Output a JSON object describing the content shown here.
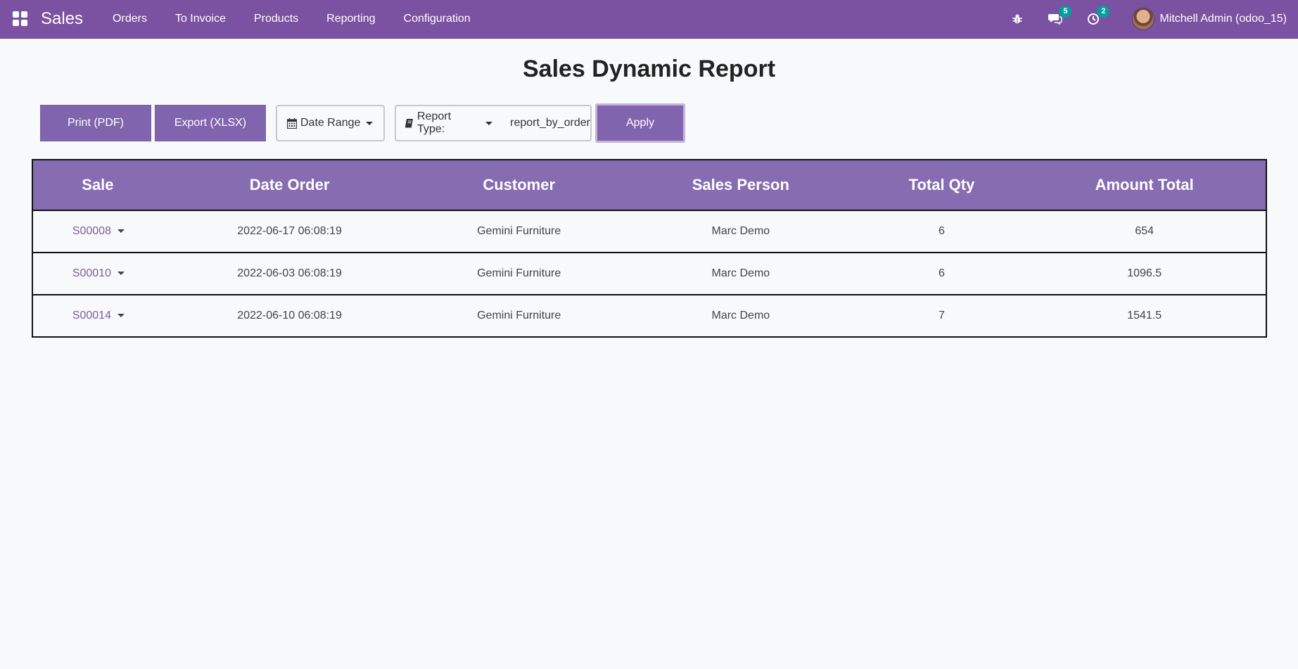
{
  "navbar": {
    "brand": "Sales",
    "items": [
      "Orders",
      "To Invoice",
      "Products",
      "Reporting",
      "Configuration"
    ],
    "messages_badge": "5",
    "activities_badge": "2",
    "user_name": "Mitchell Admin (odoo_15)"
  },
  "page": {
    "title": "Sales Dynamic Report"
  },
  "toolbar": {
    "print_label": "Print (PDF)",
    "export_label": "Export (XLSX)",
    "date_range_label": "Date Range",
    "report_type_label": "Report Type:",
    "report_type_value": "report_by_order",
    "apply_label": "Apply"
  },
  "table": {
    "headers": [
      "Sale",
      "Date Order",
      "Customer",
      "Sales Person",
      "Total Qty",
      "Amount Total"
    ],
    "rows": [
      {
        "sale": "S00008",
        "date": "2022-06-17 06:08:19",
        "customer": "Gemini Furniture",
        "salesperson": "Marc Demo",
        "qty": "6",
        "amount": "654"
      },
      {
        "sale": "S00010",
        "date": "2022-06-03 06:08:19",
        "customer": "Gemini Furniture",
        "salesperson": "Marc Demo",
        "qty": "6",
        "amount": "1096.5"
      },
      {
        "sale": "S00014",
        "date": "2022-06-10 06:08:19",
        "customer": "Gemini Furniture",
        "salesperson": "Marc Demo",
        "qty": "7",
        "amount": "1541.5"
      }
    ]
  },
  "colors": {
    "navbar": "#7b51a1",
    "button": "#8065ae",
    "table_header": "#866cb1",
    "badge": "#00a09d"
  }
}
